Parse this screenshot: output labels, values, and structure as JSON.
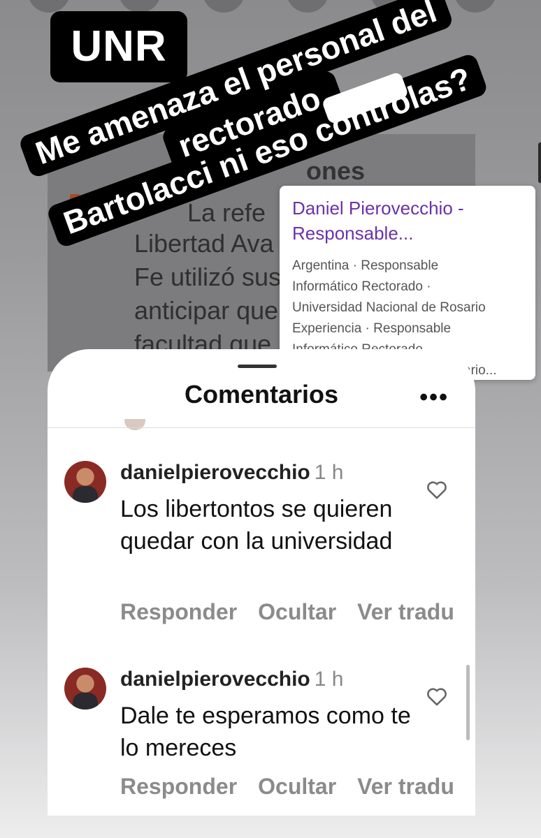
{
  "sticker": {
    "unr": "UNR",
    "line1": "Me amenaza el personal del",
    "line2": "rectorado.",
    "line3": "Bartolacci ni eso controlas?"
  },
  "background_article": {
    "heading": "ones",
    "lines": [
      "La refe",
      "Libertad Ava",
      "Fe utilizó sus",
      "anticipar que",
      "facultad que"
    ]
  },
  "search_result": {
    "title": "Daniel Pierovecchio - Responsable...",
    "snippet": "Argentina · Responsable\nInformático Rectorado ·\nUniversidad Nacional de Rosario\nExperiencia · Responsable\nInformático Rectorado.\nUniversidad Nacional de Rosario..."
  },
  "comments_panel": {
    "title": "Comentarios",
    "more_icon": "more-horizontal-icon",
    "comments": [
      {
        "username": "danielpierovecchio",
        "time": "1 h",
        "text": "Los libertontos se quieren quedar con la universidad",
        "actions": [
          "Responder",
          "Ocultar",
          "Ver tradu"
        ]
      },
      {
        "username": "danielpierovecchio",
        "time": "1 h",
        "text": "Dale te esperamos como te lo mereces",
        "actions": [
          "Responder",
          "Ocultar",
          "Ver tradu"
        ]
      }
    ]
  },
  "colors": {
    "search_title": "#6a32a8",
    "action_text": "#8b8b8b",
    "sticker_bg": "#000000"
  }
}
